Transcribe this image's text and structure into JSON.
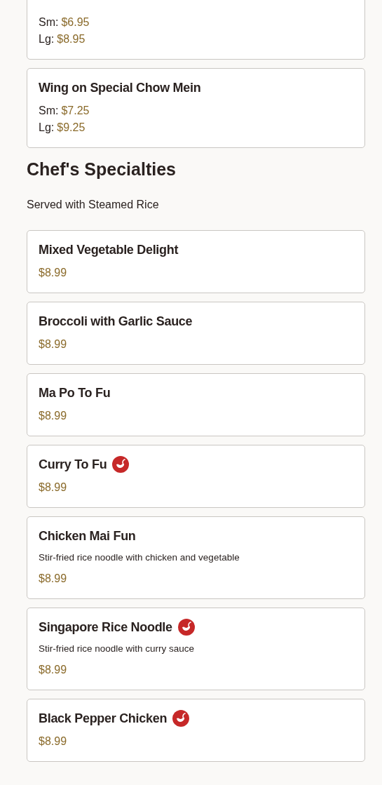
{
  "sections": [
    {
      "items": [
        {
          "spicy": false,
          "prices": [
            {
              "label": "Sm:",
              "amount": "$6.95"
            },
            {
              "label": "Lg:",
              "amount": "$8.95"
            }
          ]
        },
        {
          "name": "Wing on Special Chow Mein",
          "spicy": false,
          "prices": [
            {
              "label": "Sm:",
              "amount": "$7.25"
            },
            {
              "label": "Lg:",
              "amount": "$9.25"
            }
          ]
        }
      ]
    },
    {
      "heading": "Chef's Specialties",
      "note": "Served with Steamed Rice",
      "items": [
        {
          "name": "Mixed Vegetable Delight",
          "spicy": false,
          "price": "$8.99"
        },
        {
          "name": "Broccoli with Garlic Sauce",
          "spicy": false,
          "price": "$8.99"
        },
        {
          "name": "Ma Po To Fu",
          "spicy": false,
          "price": "$8.99"
        },
        {
          "name": "Curry To Fu",
          "spicy": true,
          "price": "$8.99"
        },
        {
          "name": "Chicken Mai Fun",
          "spicy": false,
          "description": "Stir-fried rice noodle with chicken and vegetable",
          "price": "$8.99"
        },
        {
          "name": "Singapore Rice Noodle",
          "spicy": true,
          "description": "Stir-fried rice noodle with curry sauce",
          "price": "$8.99"
        },
        {
          "name": "Black Pepper Chicken",
          "spicy": true,
          "price": "$8.99"
        }
      ]
    }
  ]
}
